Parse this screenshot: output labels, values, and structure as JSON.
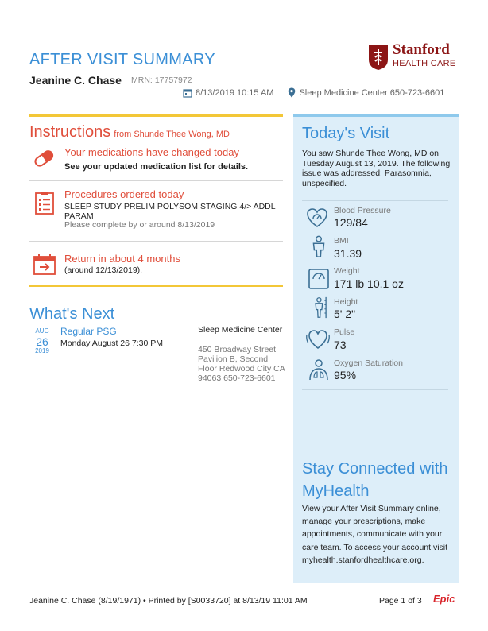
{
  "header": {
    "title": "AFTER VISIT SUMMARY",
    "patient_name": "Jeanine C. Chase",
    "mrn_label": "MRN:",
    "mrn_value": "17757972",
    "logo_word": "Stanford",
    "logo_sub": "HEALTH CARE",
    "visit_datetime": "8/13/2019 10:15 AM",
    "visit_location": "Sleep Medicine Center 650-723-6601"
  },
  "instructions": {
    "title": "Instructions",
    "from": "from Shunde Thee Wong, MD",
    "medications": {
      "title": "Your medications have changed today",
      "detail": "See your updated medication list for details."
    },
    "procedures": {
      "title": "Procedures ordered today",
      "detail": "SLEEP STUDY PRELIM POLYSOM STAGING 4/> ADDL PARAM",
      "note": "Please complete by or around 8/13/2019"
    },
    "return": {
      "title": "Return in about 4 months",
      "detail": "(around 12/13/2019)."
    }
  },
  "whats_next": {
    "title": "What's Next",
    "appointment": {
      "month": "AUG",
      "day": "26",
      "year": "2019",
      "name": "Regular PSG",
      "when": "Monday August 26 7:30 PM",
      "location": "Sleep Medicine Center",
      "address": "450 Broadway Street Pavilion B, Second Floor Redwood City CA 94063 650-723-6601"
    }
  },
  "todays_visit": {
    "title": "Today's Visit",
    "text": "You saw Shunde Thee Wong, MD on Tuesday August 13, 2019. The following issue was addressed: Parasomnia, unspecified.",
    "vitals": [
      {
        "icon": "heart-gauge-icon",
        "label": "Blood Pressure",
        "value": "129/84"
      },
      {
        "icon": "person-icon",
        "label": "BMI",
        "value": "31.39"
      },
      {
        "icon": "scale-icon",
        "label": "Weight",
        "value": "171 lb 10.1 oz"
      },
      {
        "icon": "height-ruler-icon",
        "label": "Height",
        "value": "5' 2\""
      },
      {
        "icon": "pulse-heart-icon",
        "label": "Pulse",
        "value": "73"
      },
      {
        "icon": "lungs-person-icon",
        "label": "Oxygen Saturation",
        "value": "95%"
      }
    ]
  },
  "stay_connected": {
    "title": "Stay Connected with MyHealth",
    "text": "View your After Visit Summary online, manage your prescriptions, make appointments, communicate with your care team. To access your account visit myhealth.stanfordhealthcare.org."
  },
  "footer": {
    "left": "Jeanine C. Chase (8/19/1971) • Printed by [S0033720] at 8/13/19 11:01 AM",
    "page": "Page 1 of 3",
    "logo": "Epic"
  },
  "colors": {
    "blue_heading": "#3b8fd6",
    "red_accent": "#e04e3b",
    "yellow_rule": "#f3c737",
    "panel_bg": "#ddeef9",
    "stanford_red": "#8c1515"
  }
}
